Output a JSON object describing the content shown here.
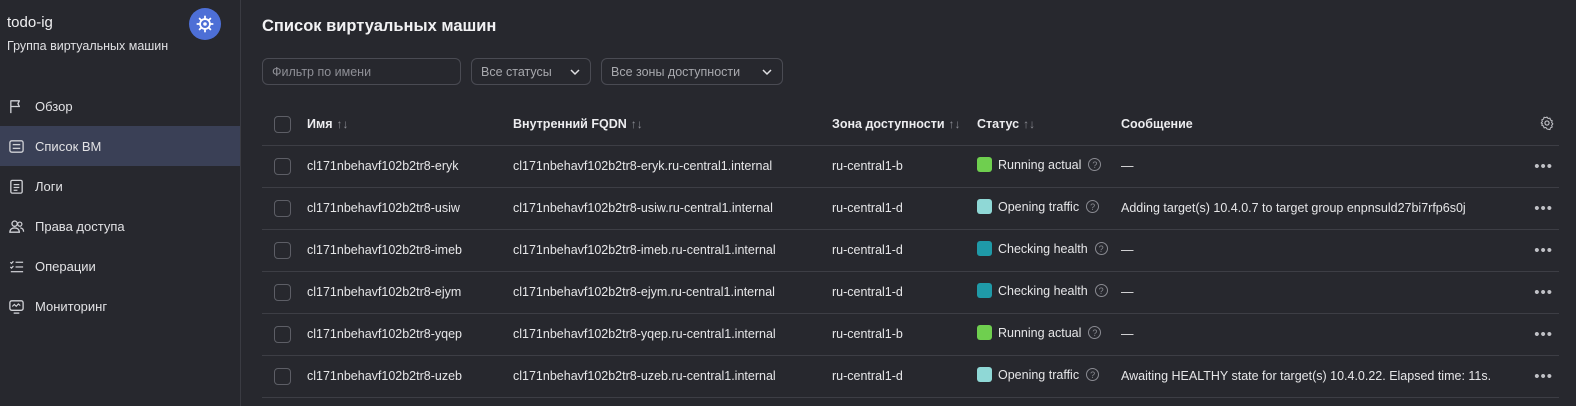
{
  "sidebar": {
    "title": "todo-ig",
    "subtitle": "Группа виртуальных машин",
    "service_icon": "instance-group-icon",
    "accent_color": "#4d6fd6",
    "items": [
      {
        "label": "Обзор",
        "icon": "flag-icon"
      },
      {
        "label": "Список ВМ",
        "icon": "list-icon",
        "active": true
      },
      {
        "label": "Логи",
        "icon": "log-icon"
      },
      {
        "label": "Права доступа",
        "icon": "users-icon"
      },
      {
        "label": "Операции",
        "icon": "operations-icon"
      },
      {
        "label": "Мониторинг",
        "icon": "monitoring-icon"
      }
    ]
  },
  "main": {
    "title": "Список виртуальных машин",
    "filters": {
      "name_placeholder": "Фильтр по имени",
      "status_select": "Все статусы",
      "zone_select": "Все зоны доступности"
    },
    "table": {
      "headers": {
        "name": "Имя",
        "fqdn": "Внутренний FQDN",
        "zone": "Зона доступности",
        "status": "Статус",
        "message": "Сообщение"
      },
      "rows": [
        {
          "name": "cl171nbehavf102b2tr8-eryk",
          "fqdn": "cl171nbehavf102b2tr8-eryk.ru-central1.internal",
          "zone": "ru-central1-b",
          "status": "Running actual",
          "status_color": "#6fcf4f",
          "message": "—"
        },
        {
          "name": "cl171nbehavf102b2tr8-usiw",
          "fqdn": "cl171nbehavf102b2tr8-usiw.ru-central1.internal",
          "zone": "ru-central1-d",
          "status": "Opening traffic",
          "status_color": "#8fd8d6",
          "message": "Adding target(s) 10.4.0.7 to target group enpnsuld27bi7rfp6s0j"
        },
        {
          "name": "cl171nbehavf102b2tr8-imeb",
          "fqdn": "cl171nbehavf102b2tr8-imeb.ru-central1.internal",
          "zone": "ru-central1-d",
          "status": "Checking health",
          "status_color": "#1f9aa8",
          "message": "—"
        },
        {
          "name": "cl171nbehavf102b2tr8-ejym",
          "fqdn": "cl171nbehavf102b2tr8-ejym.ru-central1.internal",
          "zone": "ru-central1-d",
          "status": "Checking health",
          "status_color": "#1f9aa8",
          "message": "—"
        },
        {
          "name": "cl171nbehavf102b2tr8-yqep",
          "fqdn": "cl171nbehavf102b2tr8-yqep.ru-central1.internal",
          "zone": "ru-central1-b",
          "status": "Running actual",
          "status_color": "#6fcf4f",
          "message": "—"
        },
        {
          "name": "cl171nbehavf102b2tr8-uzeb",
          "fqdn": "cl171nbehavf102b2tr8-uzeb.ru-central1.internal",
          "zone": "ru-central1-d",
          "status": "Opening traffic",
          "status_color": "#8fd8d6",
          "message": "Awaiting HEALTHY state for target(s) 10.4.0.22. Elapsed time: 11s."
        }
      ]
    }
  }
}
